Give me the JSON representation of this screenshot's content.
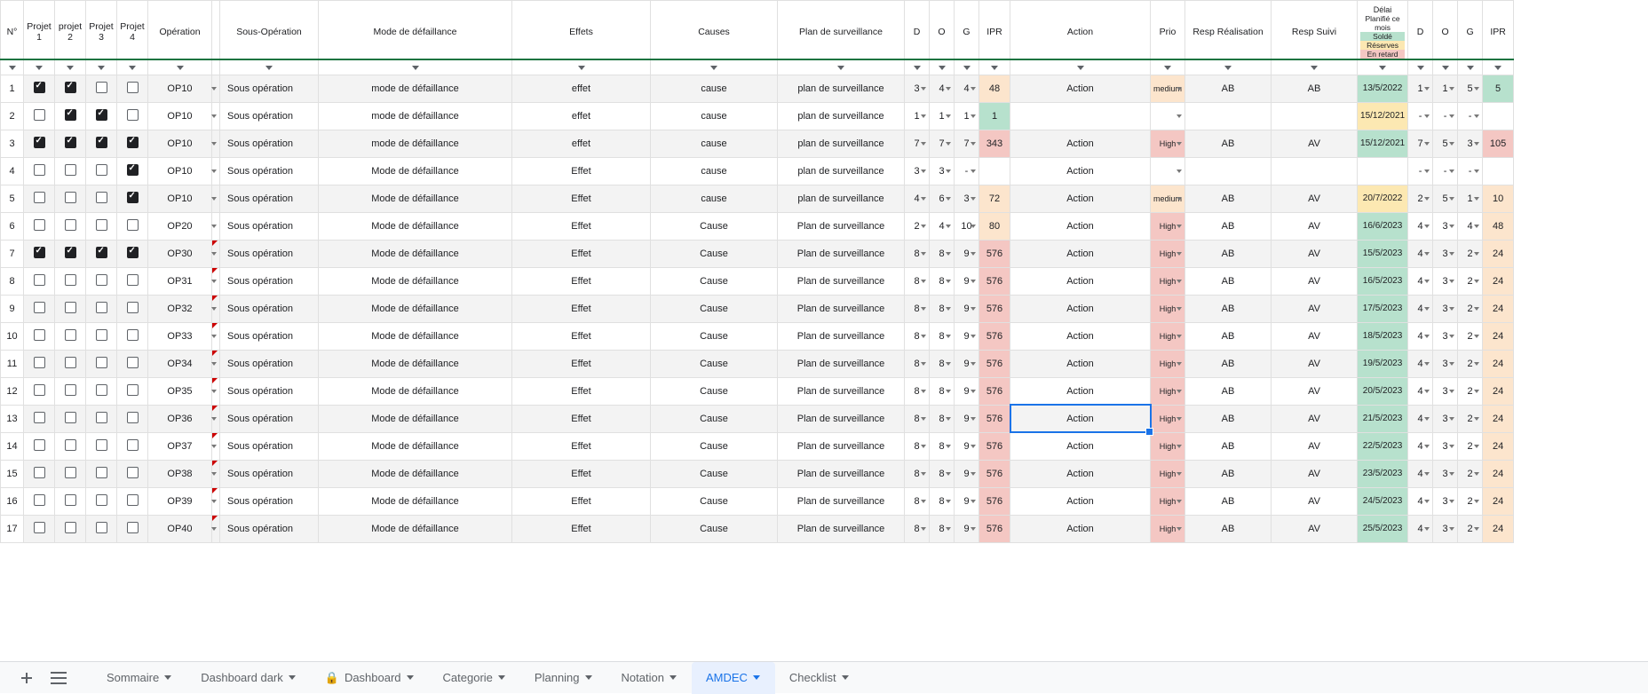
{
  "headers": {
    "n": "N°",
    "p1": "Projet 1",
    "p2": "projet 2",
    "p3": "Projet 3",
    "p4": "Projet 4",
    "op": "Opération",
    "sop": "Sous-Opération",
    "mode": "Mode de défaillance",
    "eff": "Effets",
    "cau": "Causes",
    "plan": "Plan de surveillance",
    "d": "D",
    "o": "O",
    "g": "G",
    "ipr": "IPR",
    "act": "Action",
    "prio": "Prio",
    "rr": "Resp Réalisation",
    "rs": "Resp Suivi",
    "delai": "Délai",
    "d2": "D",
    "o2": "O",
    "g2": "G",
    "ipr2": "IPR"
  },
  "legend": {
    "plan": "Planifié ce mois",
    "sol": "Soldé",
    "res": "Réserves",
    "ret": "En retard"
  },
  "rows": [
    {
      "n": 1,
      "p": [
        1,
        1,
        0,
        0
      ],
      "op": "OP10",
      "sop": "Sous opération",
      "mode": "mode de défaillance",
      "eff": "effet",
      "cau": "cause",
      "plan": "plan de surveillance",
      "d": 3,
      "o": 4,
      "g": 4,
      "ipr": 48,
      "iprc": "o",
      "act": "Action",
      "prio": "medium",
      "prioc": "o",
      "rr": "AB",
      "rs": "AB",
      "date": "13/5/2022",
      "datec": "g",
      "d2": 1,
      "o2": 1,
      "g2": 5,
      "ipr2": 5,
      "ipr2c": "g",
      "shade": 1
    },
    {
      "n": 2,
      "p": [
        0,
        1,
        1,
        0
      ],
      "op": "OP10",
      "sop": "Sous opération",
      "mode": "mode de défaillance",
      "eff": "effet",
      "cau": "cause",
      "plan": "plan de surveillance",
      "d": 1,
      "o": 1,
      "g": 1,
      "ipr": 1,
      "iprc": "g",
      "act": "",
      "prio": "",
      "prioc": "",
      "rr": "",
      "rs": "",
      "date": "15/12/2021",
      "datec": "y",
      "d2": "-",
      "o2": "-",
      "g2": "-",
      "ipr2": "",
      "ipr2c": "",
      "shade": 0
    },
    {
      "n": 3,
      "p": [
        1,
        1,
        1,
        1
      ],
      "op": "OP10",
      "sop": "Sous opération",
      "mode": "mode de défaillance",
      "eff": "effet",
      "cau": "cause",
      "plan": "plan de surveillance",
      "d": 7,
      "o": 7,
      "g": 7,
      "ipr": 343,
      "iprc": "r",
      "act": "Action",
      "prio": "High",
      "prioc": "r",
      "rr": "AB",
      "rs": "AV",
      "date": "15/12/2021",
      "datec": "g",
      "d2": 7,
      "o2": 5,
      "g2": 3,
      "ipr2": 105,
      "ipr2c": "r",
      "shade": 1
    },
    {
      "n": 4,
      "p": [
        0,
        0,
        0,
        1
      ],
      "op": "OP10",
      "sop": "Sous opération",
      "mode": "Mode de défaillance",
      "eff": "Effet",
      "cau": "cause",
      "plan": "plan de surveillance",
      "d": 3,
      "o": 3,
      "g": "-",
      "ipr": "",
      "iprc": "",
      "act": "Action",
      "prio": "",
      "prioc": "",
      "rr": "",
      "rs": "",
      "date": "",
      "datec": "",
      "d2": "-",
      "o2": "-",
      "g2": "-",
      "ipr2": "",
      "ipr2c": "",
      "shade": 0
    },
    {
      "n": 5,
      "p": [
        0,
        0,
        0,
        1
      ],
      "op": "OP10",
      "sop": "Sous opération",
      "mode": "Mode de défaillance",
      "eff": "Effet",
      "cau": "cause",
      "plan": "plan de surveillance",
      "d": 4,
      "o": 6,
      "g": 3,
      "ipr": 72,
      "iprc": "o",
      "act": "Action",
      "prio": "medium",
      "prioc": "o",
      "rr": "AB",
      "rs": "AV",
      "date": "20/7/2022",
      "datec": "y",
      "d2": 2,
      "o2": 5,
      "g2": 1,
      "ipr2": 10,
      "ipr2c": "o",
      "shade": 1
    },
    {
      "n": 6,
      "p": [
        0,
        0,
        0,
        0
      ],
      "op": "OP20",
      "sop": "Sous opération",
      "mode": "Mode de défaillance",
      "eff": "Effet",
      "cau": "Cause",
      "plan": "Plan de surveillance",
      "d": 2,
      "o": 4,
      "g": 10,
      "ipr": 80,
      "iprc": "o",
      "act": "Action",
      "prio": "High",
      "prioc": "r",
      "rr": "AB",
      "rs": "AV",
      "date": "16/6/2023",
      "datec": "g",
      "d2": 4,
      "o2": 3,
      "g2": 4,
      "ipr2": 48,
      "ipr2c": "o",
      "shade": 0
    },
    {
      "n": 7,
      "p": [
        1,
        1,
        1,
        1
      ],
      "op": "OP30",
      "sop": "Sous opération",
      "mode": "Mode de défaillance",
      "eff": "Effet",
      "cau": "Cause",
      "plan": "Plan de surveillance",
      "d": 8,
      "o": 8,
      "g": 9,
      "ipr": 576,
      "iprc": "r",
      "act": "Action",
      "prio": "High",
      "prioc": "r",
      "rr": "AB",
      "rs": "AV",
      "date": "15/5/2023",
      "datec": "g",
      "d2": 4,
      "o2": 3,
      "g2": 2,
      "ipr2": 24,
      "ipr2c": "o",
      "shade": 1,
      "mark": 1
    },
    {
      "n": 8,
      "p": [
        0,
        0,
        0,
        0
      ],
      "op": "OP31",
      "sop": "Sous opération",
      "mode": "Mode de défaillance",
      "eff": "Effet",
      "cau": "Cause",
      "plan": "Plan de surveillance",
      "d": 8,
      "o": 8,
      "g": 9,
      "ipr": 576,
      "iprc": "r",
      "act": "Action",
      "prio": "High",
      "prioc": "r",
      "rr": "AB",
      "rs": "AV",
      "date": "16/5/2023",
      "datec": "g",
      "d2": 4,
      "o2": 3,
      "g2": 2,
      "ipr2": 24,
      "ipr2c": "o",
      "shade": 0,
      "mark": 1
    },
    {
      "n": 9,
      "p": [
        0,
        0,
        0,
        0
      ],
      "op": "OP32",
      "sop": "Sous opération",
      "mode": "Mode de défaillance",
      "eff": "Effet",
      "cau": "Cause",
      "plan": "Plan de surveillance",
      "d": 8,
      "o": 8,
      "g": 9,
      "ipr": 576,
      "iprc": "r",
      "act": "Action",
      "prio": "High",
      "prioc": "r",
      "rr": "AB",
      "rs": "AV",
      "date": "17/5/2023",
      "datec": "g",
      "d2": 4,
      "o2": 3,
      "g2": 2,
      "ipr2": 24,
      "ipr2c": "o",
      "shade": 1,
      "mark": 1
    },
    {
      "n": 10,
      "p": [
        0,
        0,
        0,
        0
      ],
      "op": "OP33",
      "sop": "Sous opération",
      "mode": "Mode de défaillance",
      "eff": "Effet",
      "cau": "Cause",
      "plan": "Plan de surveillance",
      "d": 8,
      "o": 8,
      "g": 9,
      "ipr": 576,
      "iprc": "r",
      "act": "Action",
      "prio": "High",
      "prioc": "r",
      "rr": "AB",
      "rs": "AV",
      "date": "18/5/2023",
      "datec": "g",
      "d2": 4,
      "o2": 3,
      "g2": 2,
      "ipr2": 24,
      "ipr2c": "o",
      "shade": 0,
      "mark": 1
    },
    {
      "n": 11,
      "p": [
        0,
        0,
        0,
        0
      ],
      "op": "OP34",
      "sop": "Sous opération",
      "mode": "Mode de défaillance",
      "eff": "Effet",
      "cau": "Cause",
      "plan": "Plan de surveillance",
      "d": 8,
      "o": 8,
      "g": 9,
      "ipr": 576,
      "iprc": "r",
      "act": "Action",
      "prio": "High",
      "prioc": "r",
      "rr": "AB",
      "rs": "AV",
      "date": "19/5/2023",
      "datec": "g",
      "d2": 4,
      "o2": 3,
      "g2": 2,
      "ipr2": 24,
      "ipr2c": "o",
      "shade": 1,
      "mark": 1
    },
    {
      "n": 12,
      "p": [
        0,
        0,
        0,
        0
      ],
      "op": "OP35",
      "sop": "Sous opération",
      "mode": "Mode de défaillance",
      "eff": "Effet",
      "cau": "Cause",
      "plan": "Plan de surveillance",
      "d": 8,
      "o": 8,
      "g": 9,
      "ipr": 576,
      "iprc": "r",
      "act": "Action",
      "prio": "High",
      "prioc": "r",
      "rr": "AB",
      "rs": "AV",
      "date": "20/5/2023",
      "datec": "g",
      "d2": 4,
      "o2": 3,
      "g2": 2,
      "ipr2": 24,
      "ipr2c": "o",
      "shade": 0,
      "mark": 1
    },
    {
      "n": 13,
      "p": [
        0,
        0,
        0,
        0
      ],
      "op": "OP36",
      "sop": "Sous opération",
      "mode": "Mode de défaillance",
      "eff": "Effet",
      "cau": "Cause",
      "plan": "Plan de surveillance",
      "d": 8,
      "o": 8,
      "g": 9,
      "ipr": 576,
      "iprc": "r",
      "act": "Action",
      "prio": "High",
      "prioc": "r",
      "rr": "AB",
      "rs": "AV",
      "date": "21/5/2023",
      "datec": "g",
      "d2": 4,
      "o2": 3,
      "g2": 2,
      "ipr2": 24,
      "ipr2c": "o",
      "shade": 1,
      "mark": 1,
      "sel": 1
    },
    {
      "n": 14,
      "p": [
        0,
        0,
        0,
        0
      ],
      "op": "OP37",
      "sop": "Sous opération",
      "mode": "Mode de défaillance",
      "eff": "Effet",
      "cau": "Cause",
      "plan": "Plan de surveillance",
      "d": 8,
      "o": 8,
      "g": 9,
      "ipr": 576,
      "iprc": "r",
      "act": "Action",
      "prio": "High",
      "prioc": "r",
      "rr": "AB",
      "rs": "AV",
      "date": "22/5/2023",
      "datec": "g",
      "d2": 4,
      "o2": 3,
      "g2": 2,
      "ipr2": 24,
      "ipr2c": "o",
      "shade": 0,
      "mark": 1
    },
    {
      "n": 15,
      "p": [
        0,
        0,
        0,
        0
      ],
      "op": "OP38",
      "sop": "Sous opération",
      "mode": "Mode de défaillance",
      "eff": "Effet",
      "cau": "Cause",
      "plan": "Plan de surveillance",
      "d": 8,
      "o": 8,
      "g": 9,
      "ipr": 576,
      "iprc": "r",
      "act": "Action",
      "prio": "High",
      "prioc": "r",
      "rr": "AB",
      "rs": "AV",
      "date": "23/5/2023",
      "datec": "g",
      "d2": 4,
      "o2": 3,
      "g2": 2,
      "ipr2": 24,
      "ipr2c": "o",
      "shade": 1,
      "mark": 1
    },
    {
      "n": 16,
      "p": [
        0,
        0,
        0,
        0
      ],
      "op": "OP39",
      "sop": "Sous opération",
      "mode": "Mode de défaillance",
      "eff": "Effet",
      "cau": "Cause",
      "plan": "Plan de surveillance",
      "d": 8,
      "o": 8,
      "g": 9,
      "ipr": 576,
      "iprc": "r",
      "act": "Action",
      "prio": "High",
      "prioc": "r",
      "rr": "AB",
      "rs": "AV",
      "date": "24/5/2023",
      "datec": "g",
      "d2": 4,
      "o2": 3,
      "g2": 2,
      "ipr2": 24,
      "ipr2c": "o",
      "shade": 0,
      "mark": 1
    },
    {
      "n": 17,
      "p": [
        0,
        0,
        0,
        0
      ],
      "op": "OP40",
      "sop": "Sous opération",
      "mode": "Mode de défaillance",
      "eff": "Effet",
      "cau": "Cause",
      "plan": "Plan de surveillance",
      "d": 8,
      "o": 8,
      "g": 9,
      "ipr": 576,
      "iprc": "r",
      "act": "Action",
      "prio": "High",
      "prioc": "r",
      "rr": "AB",
      "rs": "AV",
      "date": "25/5/2023",
      "datec": "g",
      "d2": 4,
      "o2": 3,
      "g2": 2,
      "ipr2": 24,
      "ipr2c": "o",
      "shade": 1,
      "mark": 1
    }
  ],
  "tabs": {
    "sommaire": "Sommaire",
    "dashdark": "Dashboard dark",
    "dashboard": "Dashboard",
    "categorie": "Categorie",
    "planning": "Planning",
    "notation": "Notation",
    "amdec": "AMDEC",
    "checklist": "Checklist"
  }
}
